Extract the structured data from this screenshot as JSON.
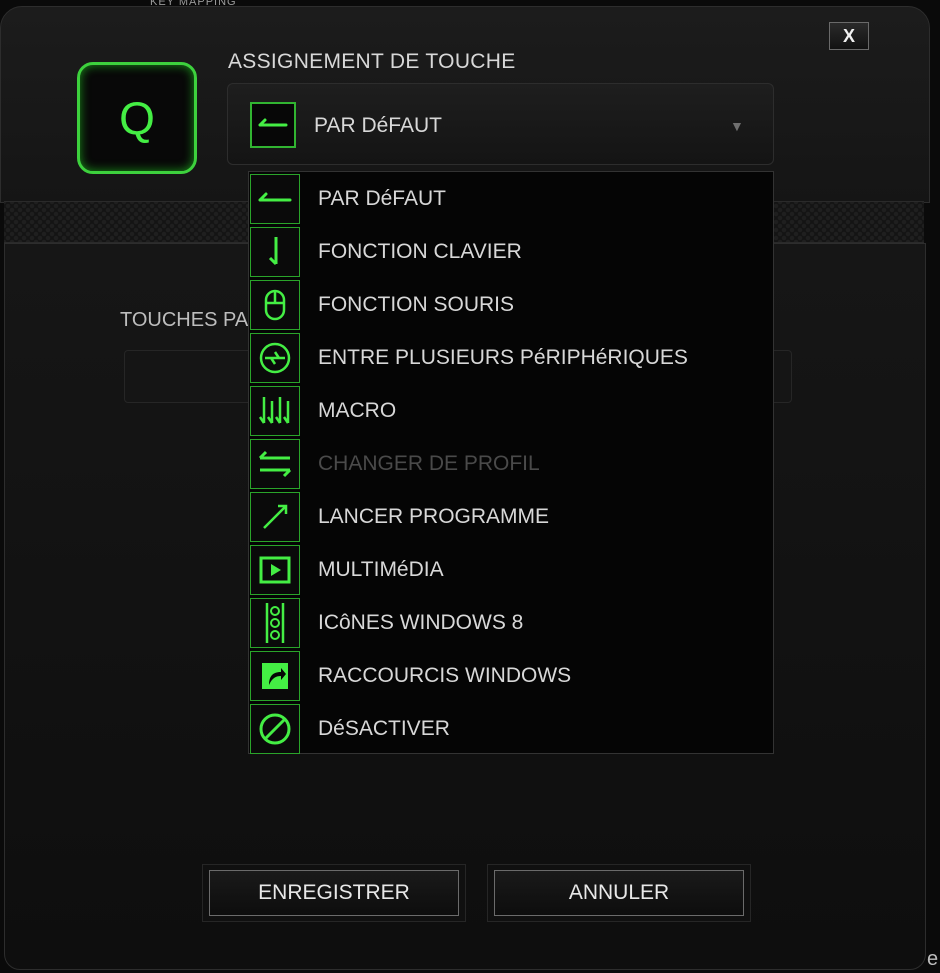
{
  "top_clip_text": "KEY MAPPING",
  "dialog": {
    "close_label": "X",
    "key_letter": "Q",
    "assign_label": "ASSIGNEMENT DE TOUCHE",
    "selected": {
      "label": "PAR DéFAUT",
      "icon": "default-arrow-icon"
    },
    "touches_label": "TOUCHES PA"
  },
  "dropdown": {
    "items": [
      {
        "label": "PAR DéFAUT",
        "icon": "default-arrow-icon",
        "enabled": true
      },
      {
        "label": "FONCTION CLAVIER",
        "icon": "keyboard-function-icon",
        "enabled": true
      },
      {
        "label": "FONCTION SOURIS",
        "icon": "mouse-icon",
        "enabled": true
      },
      {
        "label": "ENTRE PLUSIEURS PéRIPHéRIQUES",
        "icon": "inter-device-icon",
        "enabled": true
      },
      {
        "label": "MACRO",
        "icon": "macro-icon",
        "enabled": true
      },
      {
        "label": "CHANGER DE PROFIL",
        "icon": "switch-profile-icon",
        "enabled": false
      },
      {
        "label": "LANCER PROGRAMME",
        "icon": "launch-program-icon",
        "enabled": true
      },
      {
        "label": "MULTIMéDIA",
        "icon": "multimedia-icon",
        "enabled": true
      },
      {
        "label": "ICôNES WINDOWS 8",
        "icon": "windows8-charms-icon",
        "enabled": true
      },
      {
        "label": "RACCOURCIS WINDOWS",
        "icon": "windows-shortcut-icon",
        "enabled": true
      },
      {
        "label": "DéSACTIVER",
        "icon": "disable-icon",
        "enabled": true
      }
    ]
  },
  "buttons": {
    "save": "ENREGISTRER",
    "cancel": "ANNULER"
  },
  "corner_letter": "e",
  "colors": {
    "accent": "#3dd13d",
    "text": "#d8d8d8",
    "disabled_text": "#4a4a4a"
  }
}
